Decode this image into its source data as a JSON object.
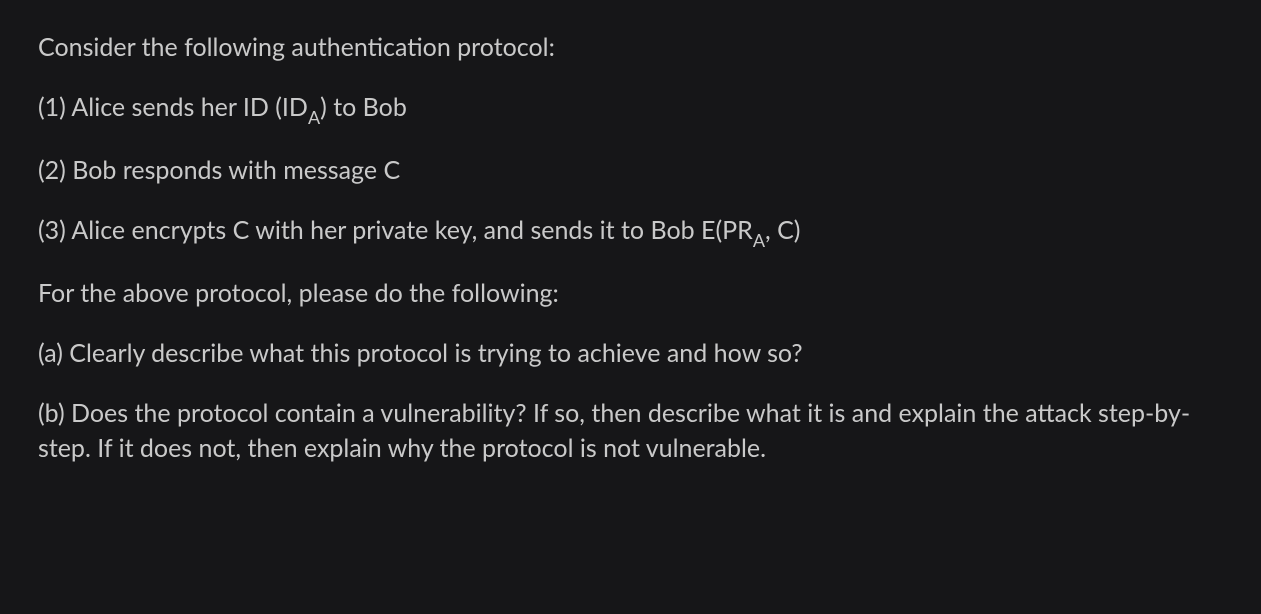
{
  "document": {
    "intro": "Consider the following authentication protocol:",
    "step1_prefix": "(1) Alice sends her ID (ID",
    "step1_sub": "A",
    "step1_suffix": ") to Bob",
    "step2": "(2) Bob responds with message C",
    "step3_prefix": "(3) Alice encrypts C with her private key, and sends it to Bob E(PR",
    "step3_sub": "A",
    "step3_suffix": ", C)",
    "instructions": "For the above protocol, please do the following:",
    "part_a": "(a) Clearly describe what this protocol is trying to achieve and how so?",
    "part_b": "(b) Does the protocol contain a vulnerability? If so, then describe what it is and explain the attack step-by-step.  If it does not, then explain why the protocol is not vulnerable."
  }
}
